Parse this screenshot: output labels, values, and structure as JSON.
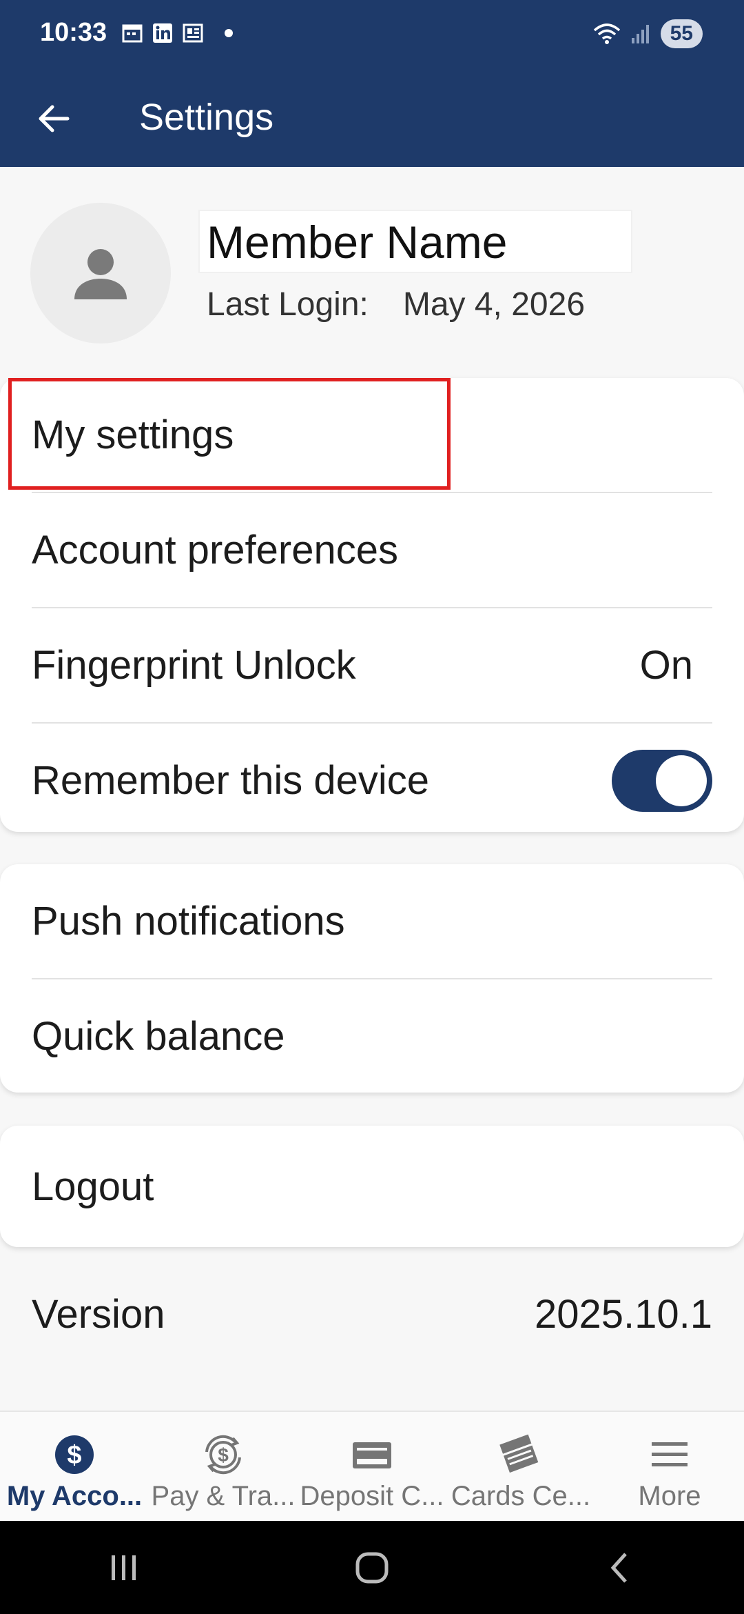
{
  "status_bar": {
    "time": "10:33",
    "battery": "55",
    "icons": [
      "calendar-icon",
      "linkedin-icon",
      "news-icon",
      "notification-dot",
      "wifi-icon",
      "signal-icon"
    ]
  },
  "appbar": {
    "title": "Settings",
    "back_icon": "arrow-left-icon"
  },
  "profile": {
    "member_name": "Member Name",
    "last_login_label": "Last Login:",
    "last_login_date": "May 4, 2026"
  },
  "settings_group_1": {
    "items": [
      {
        "label": "My settings"
      },
      {
        "label": "Account preferences"
      },
      {
        "label": "Fingerprint Unlock",
        "value": "On"
      },
      {
        "label": "Remember this device",
        "toggle": true
      }
    ]
  },
  "settings_group_2": {
    "items": [
      {
        "label": "Push notifications"
      },
      {
        "label": "Quick balance"
      }
    ]
  },
  "settings_group_3": {
    "items": [
      {
        "label": "Logout"
      }
    ]
  },
  "version": {
    "label": "Version",
    "value": "2025.10.1"
  },
  "bottom_nav": {
    "items": [
      {
        "label": "My Acco...",
        "icon": "dollar-circle-icon",
        "active": true
      },
      {
        "label": "Pay & Tra...",
        "icon": "transfer-dollar-icon"
      },
      {
        "label": "Deposit C...",
        "icon": "check-deposit-icon"
      },
      {
        "label": "Cards Ce...",
        "icon": "cards-icon"
      },
      {
        "label": "More",
        "icon": "menu-icon"
      }
    ]
  },
  "colors": {
    "primary": "#1e3a6a",
    "highlight": "#e02020"
  }
}
